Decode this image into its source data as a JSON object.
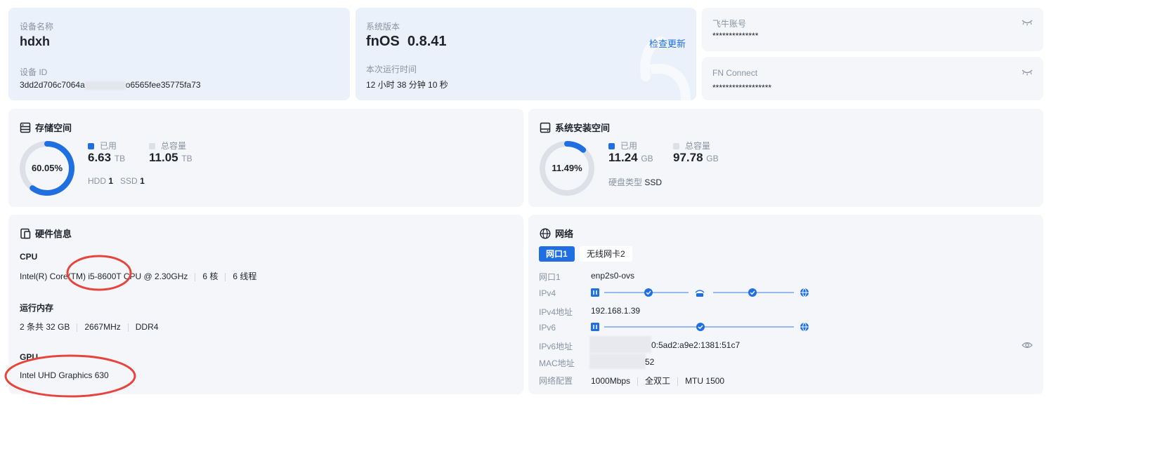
{
  "device": {
    "name_label": "设备名称",
    "name": "hdxh",
    "id_label": "设备 ID",
    "id_prefix": "3dd2d706c7064a",
    "id_suffix": "o6565fee35775fa73"
  },
  "system": {
    "version_label": "系统版本",
    "os": "fnOS",
    "version": "0.8.41",
    "check_update": "检查更新",
    "uptime_label": "本次运行时间",
    "uptime": "12 小时 38 分钟 10 秒"
  },
  "account": {
    "feiniu_label": "飞牛账号",
    "feiniu_value": "**************",
    "fnconnect_label": "FN Connect",
    "fnconnect_value": "******************"
  },
  "storage": {
    "title": "存储空间",
    "percent_text": "60.05%",
    "percent": 0.6005,
    "used_label": "已用",
    "used_value": "6.63",
    "used_unit": "TB",
    "total_label": "总容量",
    "total_value": "11.05",
    "total_unit": "TB",
    "hdd_label": "HDD",
    "hdd_count": "1",
    "ssd_label": "SSD",
    "ssd_count": "1"
  },
  "sysdisk": {
    "title": "系统安装空间",
    "percent_text": "11.49%",
    "percent": 0.1149,
    "used_label": "已用",
    "used_value": "11.24",
    "used_unit": "GB",
    "total_label": "总容量",
    "total_value": "97.78",
    "total_unit": "GB",
    "disk_type_label": "硬盘类型",
    "disk_type": "SSD"
  },
  "hardware": {
    "title": "硬件信息",
    "cpu_label": "CPU",
    "cpu_model": "Intel(R) Core(TM) i5-8600T CPU @ 2.30GHz",
    "cpu_cores": "6 核",
    "cpu_threads": "6 线程",
    "mem_label": "运行内存",
    "mem_size": "2 条共 32 GB",
    "mem_speed": "2667MHz",
    "mem_type": "DDR4",
    "gpu_label": "GPU",
    "gpu_model": "Intel UHD Graphics 630"
  },
  "network": {
    "title": "网络",
    "tabs": [
      "网口1",
      "无线网卡2"
    ],
    "active_tab": 0,
    "rows": [
      {
        "label": "网口1",
        "value": "enp2s0-ovs"
      },
      {
        "label": "IPv4",
        "value": ""
      },
      {
        "label": "IPv4地址",
        "value": "192.168.1.39"
      },
      {
        "label": "IPv6",
        "value": ""
      },
      {
        "label": "IPv6地址",
        "value": "0:5ad2:a9e2:1381:51c7"
      },
      {
        "label": "MAC地址",
        "value": "52"
      },
      {
        "label": "网络配置",
        "value": ""
      }
    ],
    "config_speed": "1000Mbps",
    "config_duplex": "全双工",
    "config_mtu": "MTU 1500"
  },
  "colors": {
    "accent": "#1f6fe0",
    "ring_track": "#dde1e7",
    "annotation": "#e5453d"
  }
}
